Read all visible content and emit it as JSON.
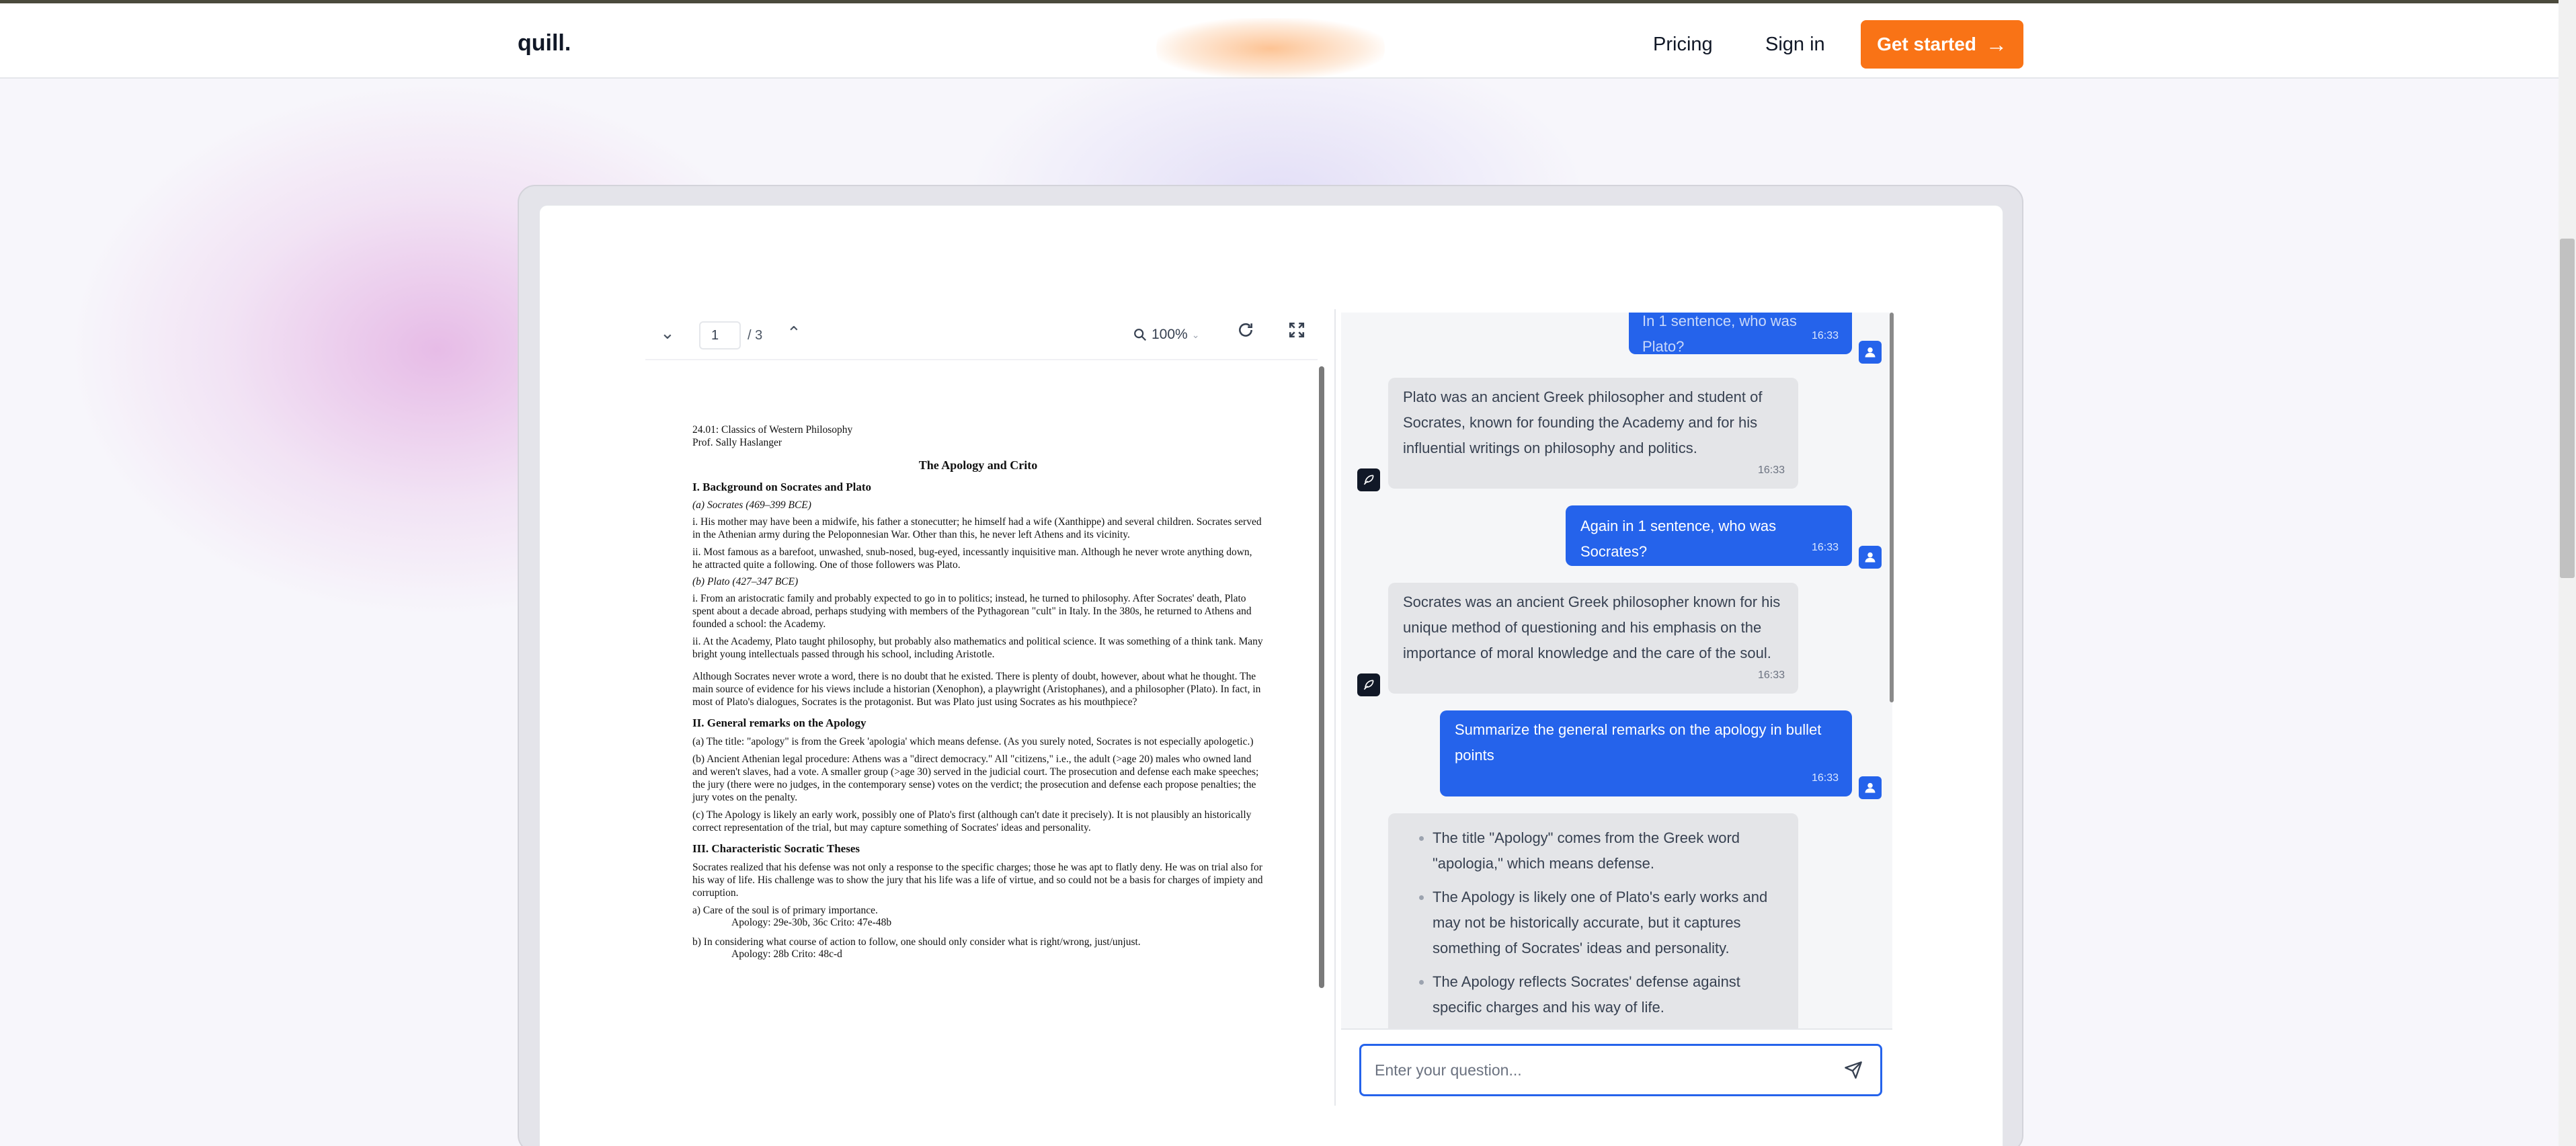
{
  "nav": {
    "logo": "quill.",
    "pricing": "Pricing",
    "sign_in": "Sign in",
    "cta": "Get started",
    "accent_color": "#f97316"
  },
  "pdf_toolbar": {
    "page_value": "1",
    "page_total": "/ 3",
    "zoom": "100%"
  },
  "pdf": {
    "header_line1": "24.01: Classics of Western Philosophy",
    "header_line2": "Prof. Sally Haslanger",
    "title": "The Apology and Crito",
    "sec1": "I.  Background on Socrates and Plato",
    "sec1_a": "(a) Socrates (469–399 BCE)",
    "sec1_a_i": "i. His mother may have been a midwife, his father a stonecutter; he himself had a wife (Xanthippe) and several children. Socrates served in the Athenian army during the Peloponnesian War. Other than this, he never left Athens and its vicinity.",
    "sec1_a_ii": "ii. Most famous as a barefoot, unwashed, snub-nosed, bug-eyed, incessantly inquisitive man. Although he never wrote anything down, he attracted quite a following. One of those followers was Plato.",
    "sec1_b": "(b) Plato (427–347 BCE)",
    "sec1_b_i": "i. From an aristocratic family and probably expected to go in to politics; instead, he turned to philosophy. After Socrates' death, Plato spent about a decade abroad, perhaps studying with members of the Pythagorean \"cult\" in Italy. In the 380s, he returned to Athens and founded a school: the Academy.",
    "sec1_b_ii": "ii. At the Academy, Plato taught philosophy, but probably also mathematics and political science. It was something of a think tank. Many bright young intellectuals passed through his school, including Aristotle.",
    "sec1_para": "Although Socrates never wrote a word, there is no doubt that he existed.  There is plenty of doubt, however, about what he thought.  The main source of evidence for his views include a historian (Xenophon), a playwright (Aristophanes), and a philosopher (Plato).  In fact, in most of Plato's dialogues, Socrates is the protagonist.  But was Plato just using Socrates as his mouthpiece?",
    "sec2": "II.  General remarks on the Apology",
    "sec2_a": "(a) The title: \"apology\" is from the Greek 'apologia' which means defense. (As you surely noted, Socrates is not especially apologetic.)",
    "sec2_b": "(b) Ancient Athenian legal procedure:  Athens was a \"direct democracy.\"  All \"citizens,\" i.e., the adult (>age 20) males who owned land and weren't slaves, had a vote.  A smaller group (>age 30) served in the judicial court.  The prosecution and defense each make speeches; the jury (there were no judges, in the contemporary sense) votes on the verdict; the prosecution and defense each propose penalties; the jury votes on the penalty.",
    "sec2_c": "(c) The Apology is likely an early work, possibly one of Plato's first (although can't date it precisely).  It is not plausibly an historically correct representation of the trial, but may capture something of Socrates' ideas and personality.",
    "sec3": "III. Characteristic Socratic Theses",
    "sec3_para": "Socrates realized that his defense was not only a response to the specific charges; those he was apt to flatly deny. He was on trial also for his way of life.  His challenge was to show the jury that his life was a life of virtue, and so could not be a basis for charges of impiety and corruption.",
    "sec3_a": "a)  Care of the soul is of primary importance.",
    "sec3_a_ref": "Apology: 29e-30b, 36c       Crito: 47e-48b",
    "sec3_b": "b)  In considering what course of action to follow, one should only consider what is right/wrong, just/unjust.",
    "sec3_b_ref": "Apology: 28b                   Crito: 48c-d"
  },
  "chat": {
    "messages": [
      {
        "role": "user",
        "text": "In 1 sentence, who was Plato?",
        "time": "16:33"
      },
      {
        "role": "bot",
        "text": "Plato was an ancient Greek philosopher and student of Socrates, known for founding the Academy and for his influential writings on philosophy and politics.",
        "time": "16:33"
      },
      {
        "role": "user",
        "text": "Again in 1 sentence, who was Socrates?",
        "time": "16:33"
      },
      {
        "role": "bot",
        "text": "Socrates was an ancient Greek philosopher known for his unique method of questioning and his emphasis on the importance of moral knowledge and the care of the soul.",
        "time": "16:33"
      },
      {
        "role": "user",
        "text": "Summarize the general remarks on the apology in bullet points",
        "time": "16:33"
      },
      {
        "role": "bot",
        "bullets": [
          "The title \"Apology\" comes from the Greek word \"apologia,\" which means defense.",
          "The Apology is likely one of Plato's early works and may not be historically accurate, but it captures something of Socrates' ideas and personality.",
          "The Apology reflects Socrates' defense against specific charges and his way of life."
        ]
      }
    ],
    "input_placeholder": "Enter your question..."
  }
}
